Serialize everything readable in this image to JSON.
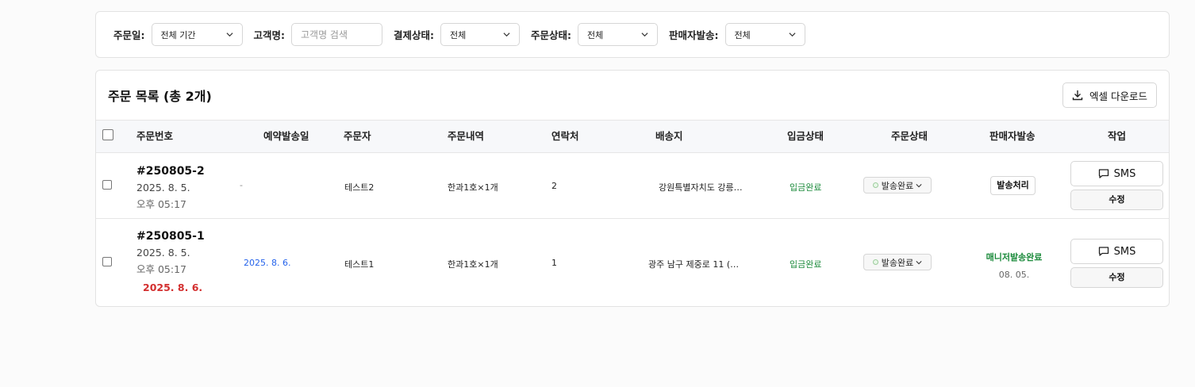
{
  "filters": {
    "order_date": {
      "label": "주문일:",
      "value": "전체 기간"
    },
    "customer": {
      "label": "고객명:",
      "placeholder": "고객명 검색"
    },
    "payment_status": {
      "label": "결제상태:",
      "value": "전체"
    },
    "order_status": {
      "label": "주문상태:",
      "value": "전체"
    },
    "seller_shipping": {
      "label": "판매자발송:",
      "value": "전체"
    }
  },
  "list": {
    "title": "주문 목록 (총 2개)",
    "download_label": "엑셀 다운로드"
  },
  "columns": [
    "주문번호",
    "예약발송일",
    "주문자",
    "주문내역",
    "연락처",
    "배송지",
    "입금상태",
    "주문상태",
    "판매자발송",
    "작업"
  ],
  "rows": [
    {
      "order_no": "#250805-2",
      "date": "2025. 8. 5.",
      "time": "오후 05:17",
      "reserve_date": "-",
      "customer": "테스트2",
      "items": "한과1호×1개",
      "phone": "2",
      "address": "강원특별자치도 강릉…",
      "payment": "입금완료",
      "status": "발송완료",
      "seller_action": "발송처리",
      "sms_label": "SMS",
      "edit_label": "수정"
    },
    {
      "order_no": "#250805-1",
      "date": "2025. 8. 5.",
      "time": "오후 05:17",
      "reserve_highlight": "2025. 8. 6.",
      "reserve_date": "2025. 8. 6.",
      "customer": "테스트1",
      "items": "한과1호×1개",
      "phone": "1",
      "address": "광주 남구 제중로 11 (…",
      "payment": "입금완료",
      "status": "발송완료",
      "seller_done": "매니저발송완료",
      "seller_done_date": "08. 05.",
      "sms_label": "SMS",
      "edit_label": "수정"
    }
  ],
  "colors": {
    "paid_green": "#1a8a3a",
    "reserve_red": "#d32f2f",
    "reserve_blue": "#2563eb"
  },
  "icons": [
    "chevron-down-icon",
    "download-icon",
    "message-icon",
    "status-dot-icon"
  ]
}
